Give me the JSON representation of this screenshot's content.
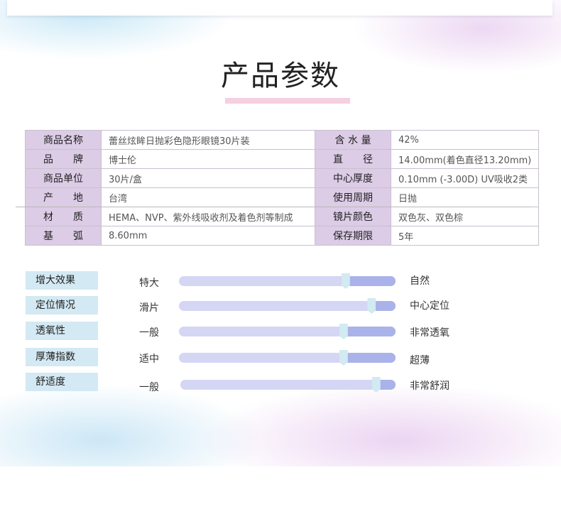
{
  "title": "产品参数",
  "params": [
    {
      "k1": "商品名称",
      "v1": "蕾丝炫眸日抛彩色隐形眼镜30片装",
      "k2": "含 水 量",
      "v2": "42%"
    },
    {
      "k1": "品　　牌",
      "v1": "博士伦",
      "k2": "直　　径",
      "v2": "14.00mm(着色直径13.20mm)"
    },
    {
      "k1": "商品单位",
      "v1": "30片/盒",
      "k2": "中心厚度",
      "v2": "0.10mm (-3.00D)  UV吸收2类"
    },
    {
      "k1": "产　　地",
      "v1": "台湾",
      "k2": "使用周期",
      "v2": "日抛"
    },
    {
      "k1": "材　　质",
      "v1": "HEMA、NVP、紫外线吸收剂及着色剂等制成",
      "k2": "镜片颜色",
      "v2": "双色灰、双色棕"
    },
    {
      "k1": "基　　弧",
      "v1": "8.60mm",
      "k2": "保存期限",
      "v2": "5年"
    }
  ],
  "sliders": [
    {
      "label": "增大效果",
      "left": "特大",
      "right": "自然",
      "value": 0.77
    },
    {
      "label": "定位情况",
      "left": "滑片",
      "right": "中心定位",
      "value": 0.89
    },
    {
      "label": "透氧性",
      "left": "一般",
      "right": "非常透氧",
      "value": 0.76
    },
    {
      "label": "厚薄指数",
      "left": "适中",
      "right": "超薄",
      "value": 0.76
    },
    {
      "label": "舒适度",
      "left": "一般",
      "right": "非常舒润",
      "value": 0.91
    }
  ],
  "colors": {
    "label_bg": "#dccce6",
    "slider_label_bg": "#d3e9f3",
    "track": "#d4d6f4",
    "track_fill": "#aab2ea",
    "thumb": "#d2eaf1",
    "title_bar": "#f6cfe0"
  }
}
